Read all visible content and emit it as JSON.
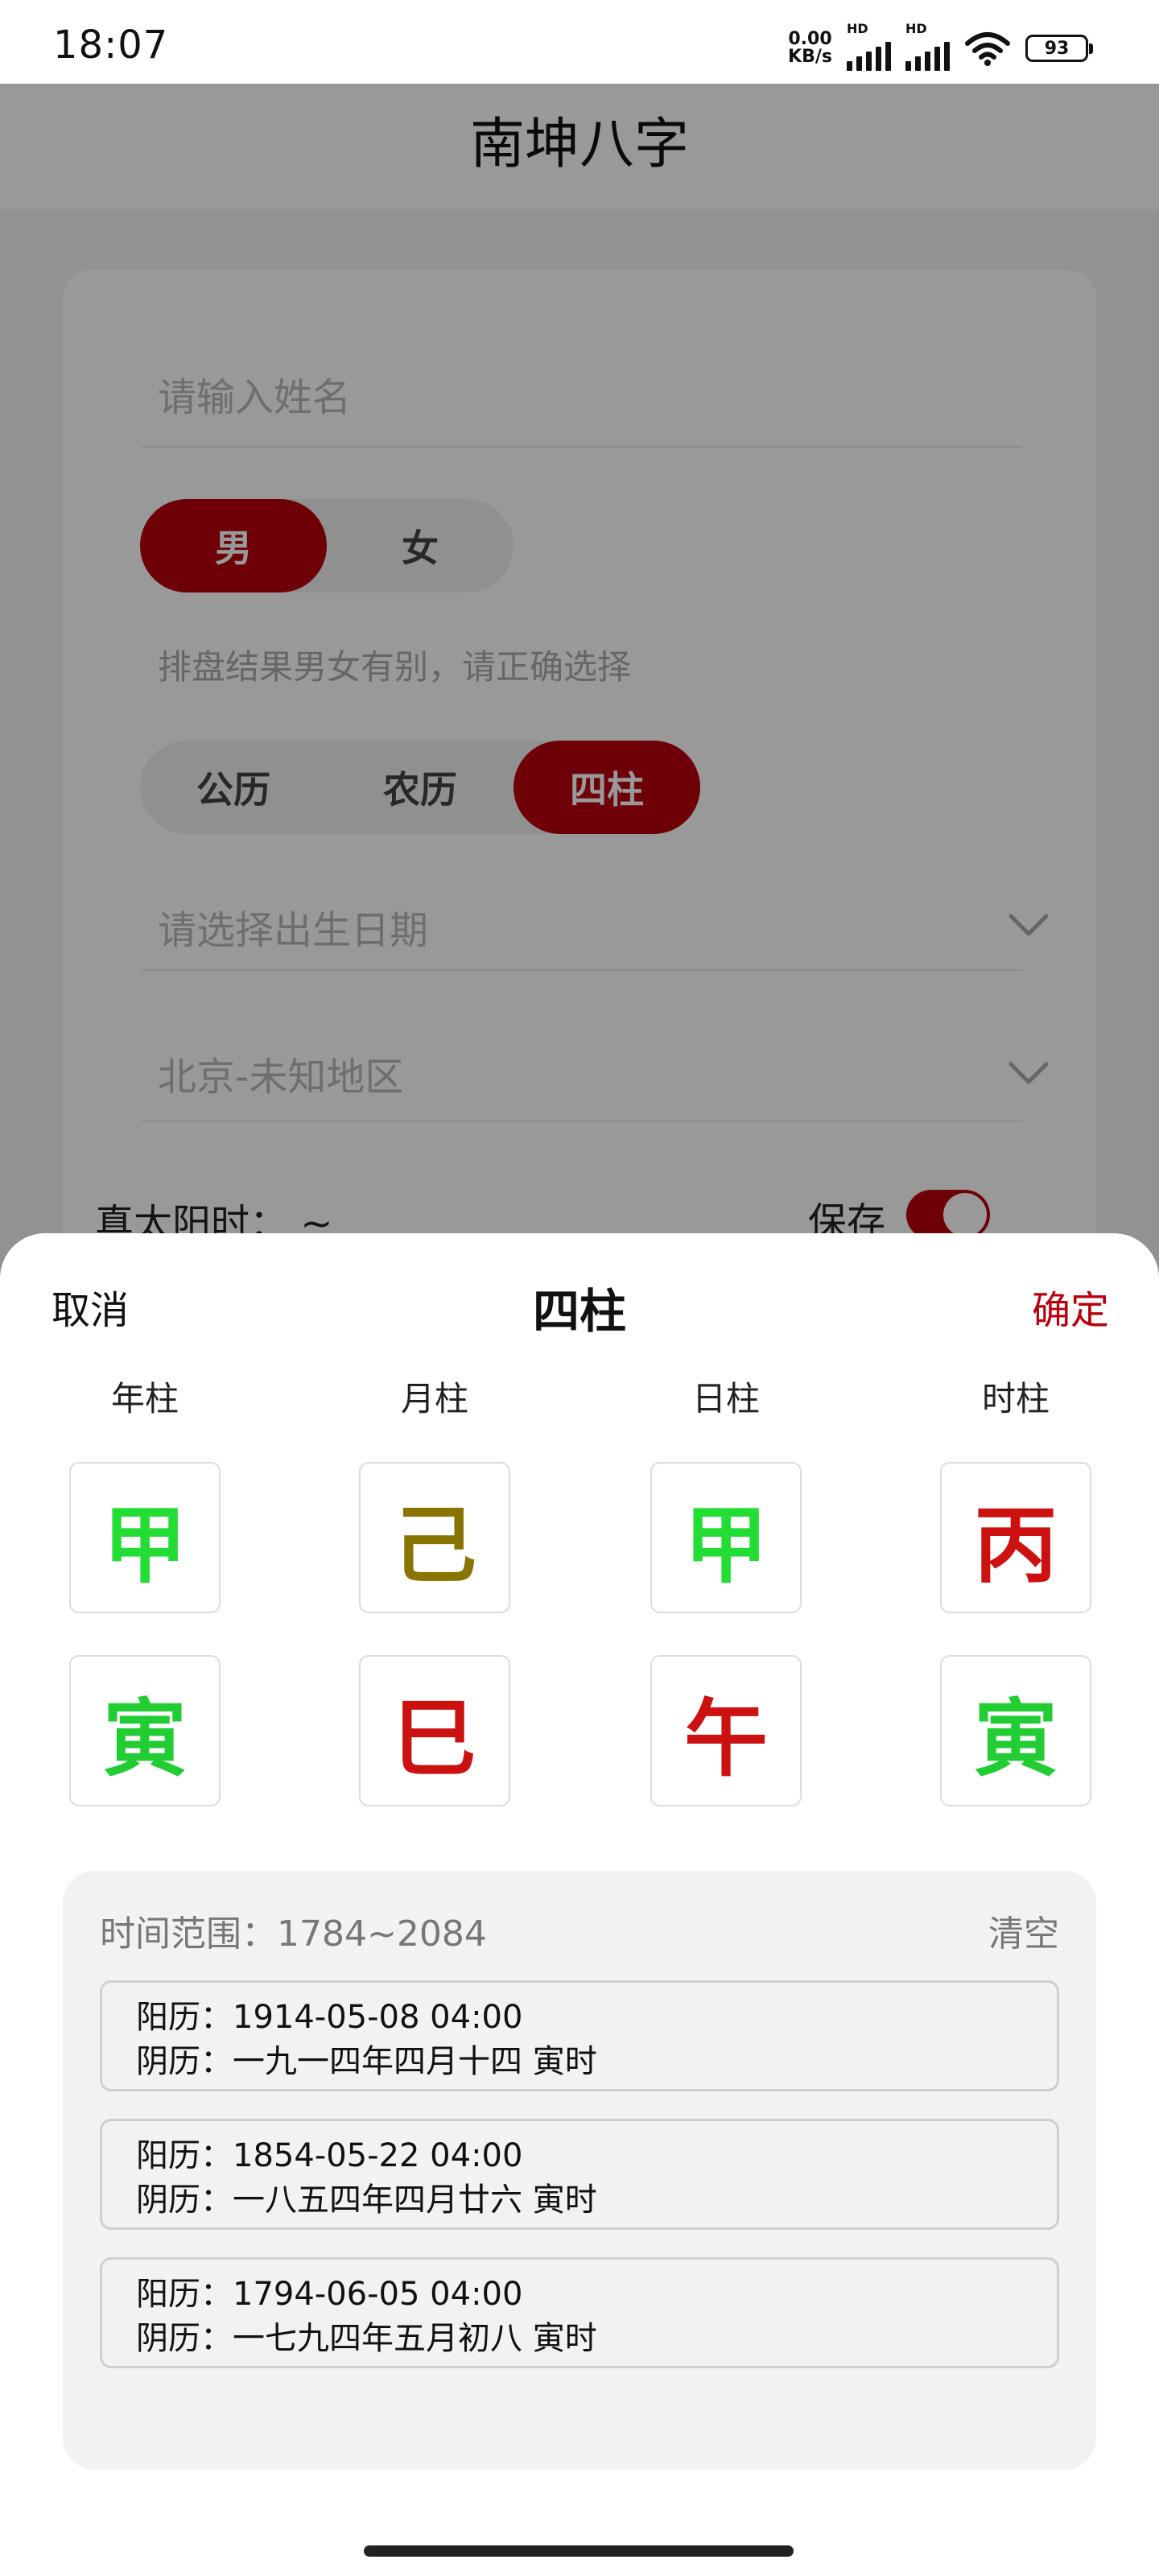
{
  "status_bar": {
    "time": "18:07",
    "net_speed_value": "0.00",
    "net_speed_unit": "KB/s",
    "sim1_label": "HD",
    "sim2_label": "HD",
    "battery": "93",
    "icons": [
      "signal-icon",
      "signal-icon",
      "wifi-icon",
      "battery-icon"
    ]
  },
  "app_bar": {
    "title": "南坤八字"
  },
  "form": {
    "name_placeholder": "请输入姓名",
    "gender_options": [
      {
        "label": "男",
        "active": true
      },
      {
        "label": "女",
        "active": false
      }
    ],
    "gender_hint": "排盘结果男女有别，请正确选择",
    "calendar_options": [
      {
        "label": "公历",
        "active": false
      },
      {
        "label": "农历",
        "active": false
      },
      {
        "label": "四柱",
        "active": true
      }
    ],
    "birth_date_placeholder": "请选择出生日期",
    "location_value": "北京-未知地区",
    "solar_time_label": "真太阳时：  ~",
    "save_label": "保存",
    "save_toggle_on": true,
    "accent_color": "#b8000e"
  },
  "sheet": {
    "cancel_label": "取消",
    "title": "四柱",
    "confirm_label": "确定",
    "columns": [
      {
        "label": "年柱",
        "stem": "甲",
        "stem_color": "#22dd33",
        "branch": "寅",
        "branch_color": "#22cc33"
      },
      {
        "label": "月柱",
        "stem": "己",
        "stem_color": "#8a7400",
        "branch": "巳",
        "branch_color": "#cc1111"
      },
      {
        "label": "日柱",
        "stem": "甲",
        "stem_color": "#22dd33",
        "branch": "午",
        "branch_color": "#cc1111"
      },
      {
        "label": "时柱",
        "stem": "丙",
        "stem_color": "#cc1111",
        "branch": "寅",
        "branch_color": "#22cc33"
      }
    ],
    "results": {
      "range_text": "时间范围：1784~2084",
      "clear_label": "清空",
      "items": [
        {
          "solar": "阳历：1914-05-08 04:00",
          "lunar": "阴历：一九一四年四月十四 寅时"
        },
        {
          "solar": "阳历：1854-05-22 04:00",
          "lunar": "阴历：一八五四年四月廿六 寅时"
        },
        {
          "solar": "阳历：1794-06-05 04:00",
          "lunar": "阴历：一七九四年五月初八 寅时"
        }
      ]
    }
  }
}
